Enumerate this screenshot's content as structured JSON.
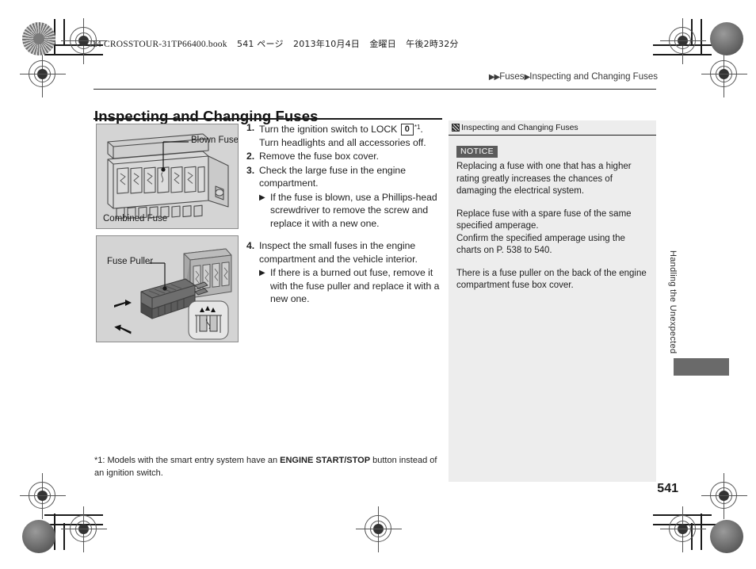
{
  "book_header": {
    "filename": "14 CROSSTOUR-31TP66400.book",
    "page_label": "541 ページ",
    "date": "2013年10月4日",
    "weekday": "金曜日",
    "time": "午後2時32分"
  },
  "breadcrumb": {
    "arrow1": "▶▶",
    "level1": "Fuses",
    "arrow2": "▶",
    "level2": "Inspecting and Changing Fuses"
  },
  "page_title": "Inspecting and Changing Fuses",
  "figures": [
    {
      "id": "combined-fuse",
      "callout_label": "Blown Fuse",
      "caption": "Combined Fuse"
    },
    {
      "id": "fuse-puller",
      "callout_label": "Fuse Puller"
    }
  ],
  "steps": [
    {
      "num": "1.",
      "text_before": "Turn the ignition switch to LOCK",
      "lock_glyph": "0",
      "footnote_ref": "*1",
      "text_after": ". Turn headlights and all accessories off."
    },
    {
      "num": "2.",
      "text": "Remove the fuse box cover."
    },
    {
      "num": "3.",
      "text": "Check the large fuse in the engine compartment.",
      "substep": {
        "marker": "▶",
        "text": "If the fuse is blown, use a Phillips-head screwdriver to remove the screw and replace it with a new one."
      }
    },
    {
      "num": "4.",
      "text": "Inspect the small fuses in the engine compartment and the vehicle interior.",
      "substep": {
        "marker": "▶",
        "text": "If there is a burned out fuse, remove it with the fuse puller and replace it with a new one."
      }
    }
  ],
  "info_panel": {
    "header": "Inspecting and Changing Fuses",
    "notice_badge": "NOTICE",
    "paragraphs": [
      "Replacing a fuse with one that has a higher rating greatly increases the chances of damaging the electrical system.",
      "Replace fuse with a spare fuse of the same specified amperage.\nConfirm the specified amperage using the charts on P. 538 to 540.",
      "There is a fuse puller on the back of the engine compartment fuse box cover."
    ]
  },
  "footnote": {
    "prefix": "*1: Models with the smart entry system have an ",
    "bold": "ENGINE START/STOP",
    "suffix": " button instead of an ignition switch."
  },
  "side_section_label": "Handling the Unexpected",
  "page_number": "541",
  "plate_label": "14",
  "colors": {
    "figure_background": "#d4d4d4",
    "panel_background": "#ededed",
    "notice_badge": "#5b5b5b",
    "side_tab": "#6a6a6a"
  }
}
